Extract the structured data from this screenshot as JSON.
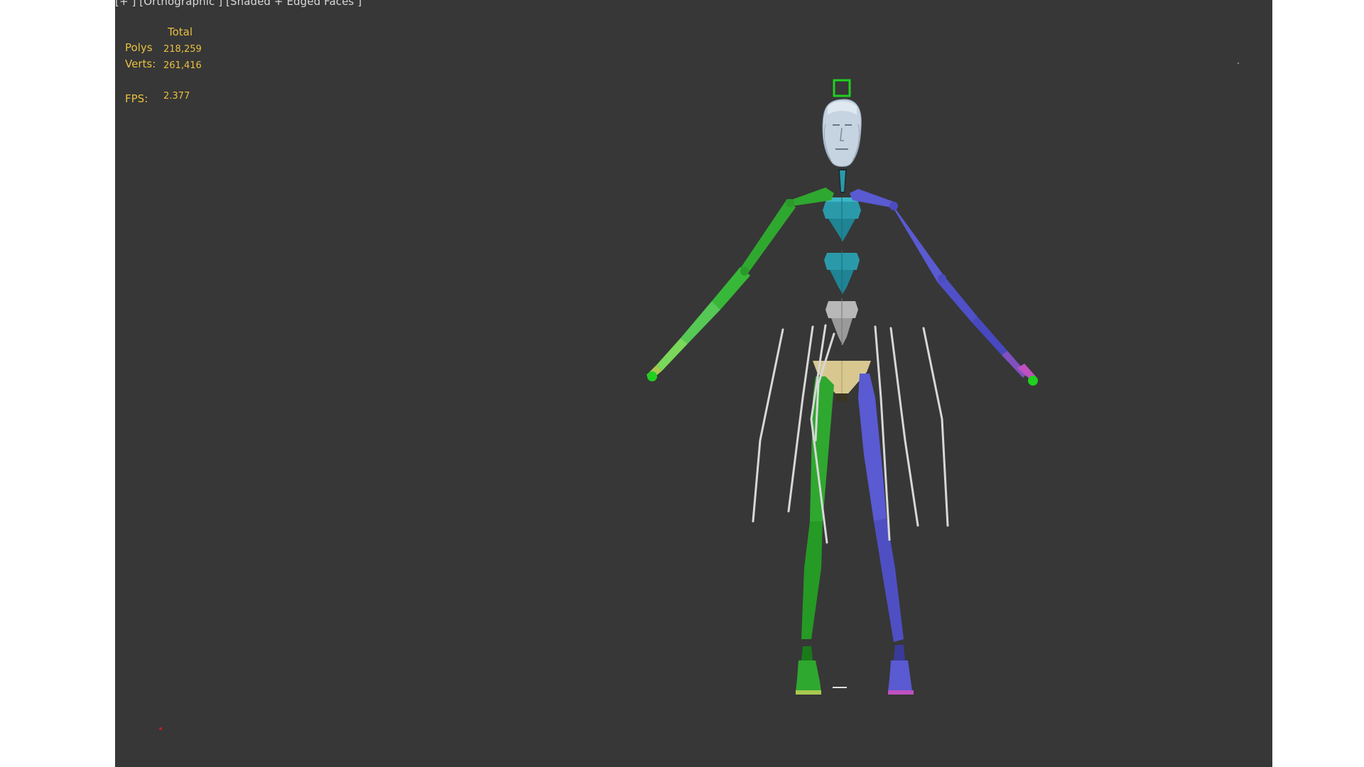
{
  "viewport": {
    "label": "[+ ] [Orthographic ] [Shaded + Edged Faces ]",
    "background_color": "#373737"
  },
  "stats": {
    "total_header": "Total",
    "rows": [
      {
        "label": "Polys",
        "value": "218,259"
      },
      {
        "label": "Verts:",
        "value": "261,416"
      }
    ],
    "fps_label": "FPS:",
    "fps_value": "2.377",
    "text_color": "#e8c040"
  },
  "scene": {
    "object": "biped-skeleton",
    "colors": {
      "left_side": "#2fa82f",
      "right_side": "#5a5ad2",
      "spine": "#2a9aaa",
      "head": "#c8d8e8",
      "pelvis": "#d8c890",
      "bones": "#d0d0d0"
    }
  }
}
